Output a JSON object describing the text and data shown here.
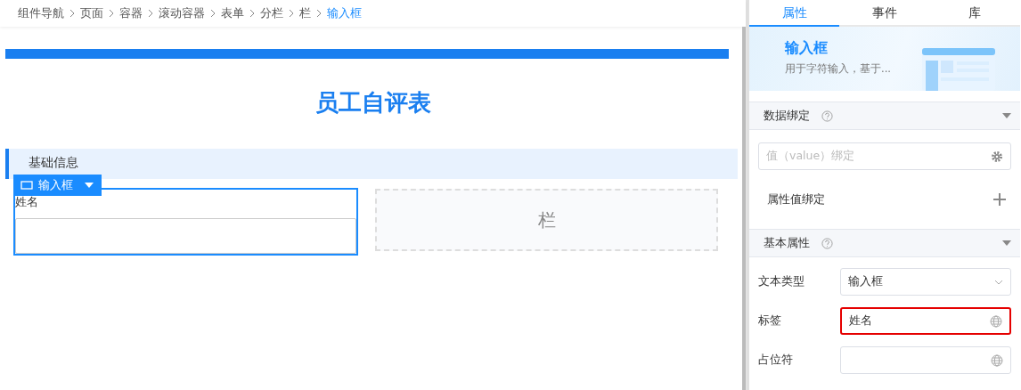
{
  "breadcrumb": [
    {
      "label": "组件导航",
      "current": false
    },
    {
      "label": "页面",
      "current": false
    },
    {
      "label": "容器",
      "current": false
    },
    {
      "label": "滚动容器",
      "current": false
    },
    {
      "label": "表单",
      "current": false
    },
    {
      "label": "分栏",
      "current": false
    },
    {
      "label": "栏",
      "current": false
    },
    {
      "label": "输入框",
      "current": true
    }
  ],
  "canvas": {
    "title": "员工自评表",
    "section": "基础信息",
    "component_tag": "输入框",
    "field_label": "姓名",
    "column_placeholder": "栏"
  },
  "panel": {
    "tabs": [
      {
        "label": "属性",
        "selected": true
      },
      {
        "label": "事件",
        "selected": false
      },
      {
        "label": "库",
        "selected": false
      }
    ],
    "header": {
      "title": "输入框",
      "description": "用于字符输入，基于..."
    },
    "data_binding": {
      "title": "数据绑定",
      "value_placeholder": "值（value）绑定",
      "property_binding_label": "属性值绑定"
    },
    "basic": {
      "title": "基本属性",
      "rows": [
        {
          "label": "文本类型",
          "kind": "select",
          "value": "输入框",
          "highlighted": false
        },
        {
          "label": "标签",
          "kind": "text",
          "value": "姓名",
          "highlighted": true
        },
        {
          "label": "占位符",
          "kind": "text",
          "highlighted": false
        }
      ]
    }
  }
}
